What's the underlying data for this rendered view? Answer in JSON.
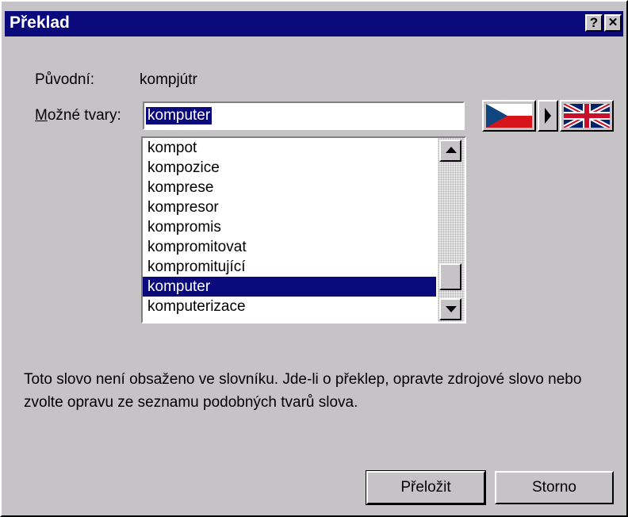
{
  "window": {
    "title": "Překlad",
    "help_button": "?",
    "close_button": "✕"
  },
  "original": {
    "label": "Původní:",
    "value": "kompjútr"
  },
  "forms": {
    "label_accel": "M",
    "label_rest": "ožné tvary:",
    "selected_value": "komputer"
  },
  "list": {
    "items": [
      "kompot",
      "kompozice",
      "komprese",
      "kompresor",
      "kompromis",
      "kompromitovat",
      "kompromitující",
      "komputer",
      "komputerizace"
    ],
    "selected_index": 7
  },
  "message": "Toto slovo není obsaženo ve slovníku. Jde-li o překlep, opravte zdrojové slovo nebo zvolte opravu ze seznamu podobných tvarů slova.",
  "buttons": {
    "translate": "Přeložit",
    "cancel": "Storno"
  },
  "colors": {
    "titlebar": "#0a0a7c",
    "dialog": "#c6c3c6",
    "selection": "#0a0a7c"
  }
}
